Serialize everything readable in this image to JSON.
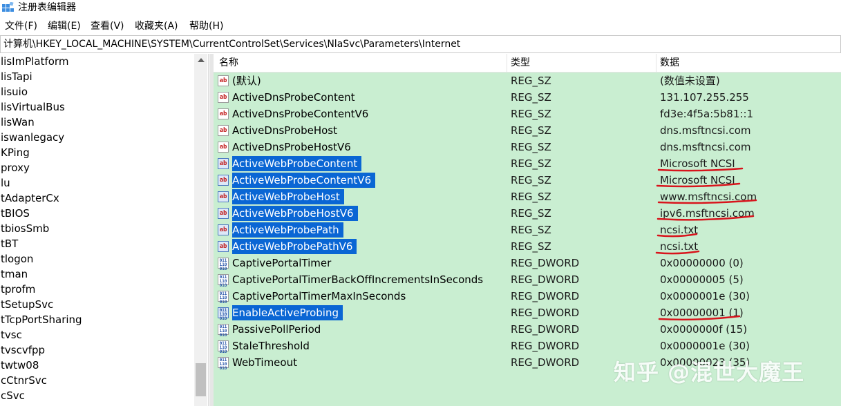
{
  "window": {
    "title": "注册表编辑器"
  },
  "menu": [
    "文件(F)",
    "编辑(E)",
    "查看(V)",
    "收藏夹(A)",
    "帮助(H)"
  ],
  "address": "计算机\\HKEY_LOCAL_MACHINE\\SYSTEM\\CurrentControlSet\\Services\\NlaSvc\\Parameters\\Internet",
  "tree": [
    "lisImPlatform",
    "lisTapi",
    "lisuio",
    "lisVirtualBus",
    "lisWan",
    "iswanlegacy",
    "KPing",
    "proxy",
    "lu",
    "tAdapterCx",
    "tBIOS",
    "tbiosSmb",
    "tBT",
    "tlogon",
    "tman",
    "tprofm",
    "tSetupSvc",
    "tTcpPortSharing",
    "tvsc",
    "tvscvfpp",
    "twtw08",
    "cCtnrSvc",
    "cSvc"
  ],
  "columns": {
    "name": "名称",
    "type": "类型",
    "data": "数据"
  },
  "values": [
    {
      "name": "(默认)",
      "type": "REG_SZ",
      "data": "(数值未设置)",
      "icon": "string-value-icon",
      "selected": false
    },
    {
      "name": "ActiveDnsProbeContent",
      "type": "REG_SZ",
      "data": "131.107.255.255",
      "icon": "string-value-icon",
      "selected": false
    },
    {
      "name": "ActiveDnsProbeContentV6",
      "type": "REG_SZ",
      "data": "fd3e:4f5a:5b81::1",
      "icon": "string-value-icon",
      "selected": false
    },
    {
      "name": "ActiveDnsProbeHost",
      "type": "REG_SZ",
      "data": "dns.msftncsi.com",
      "icon": "string-value-icon",
      "selected": false
    },
    {
      "name": "ActiveDnsProbeHostV6",
      "type": "REG_SZ",
      "data": "dns.msftncsi.com",
      "icon": "string-value-icon",
      "selected": false
    },
    {
      "name": "ActiveWebProbeContent",
      "type": "REG_SZ",
      "data": "Microsoft NCSI",
      "icon": "string-value-icon",
      "selected": true
    },
    {
      "name": "ActiveWebProbeContentV6",
      "type": "REG_SZ",
      "data": "Microsoft NCSI",
      "icon": "string-value-icon",
      "selected": true
    },
    {
      "name": "ActiveWebProbeHost",
      "type": "REG_SZ",
      "data": "www.msftncsi.com",
      "icon": "string-value-icon",
      "selected": true
    },
    {
      "name": "ActiveWebProbeHostV6",
      "type": "REG_SZ",
      "data": "ipv6.msftncsi.com",
      "icon": "string-value-icon",
      "selected": true
    },
    {
      "name": "ActiveWebProbePath",
      "type": "REG_SZ",
      "data": "ncsi.txt",
      "icon": "string-value-icon",
      "selected": true
    },
    {
      "name": "ActiveWebProbePathV6",
      "type": "REG_SZ",
      "data": "ncsi.txt",
      "icon": "string-value-icon",
      "selected": true
    },
    {
      "name": "CaptivePortalTimer",
      "type": "REG_DWORD",
      "data": "0x00000000 (0)",
      "icon": "dword-value-icon",
      "selected": false
    },
    {
      "name": "CaptivePortalTimerBackOffIncrementsInSeconds",
      "type": "REG_DWORD",
      "data": "0x00000005 (5)",
      "icon": "dword-value-icon",
      "selected": false
    },
    {
      "name": "CaptivePortalTimerMaxInSeconds",
      "type": "REG_DWORD",
      "data": "0x0000001e (30)",
      "icon": "dword-value-icon",
      "selected": false
    },
    {
      "name": "EnableActiveProbing",
      "type": "REG_DWORD",
      "data": "0x00000001 (1)",
      "icon": "dword-value-icon",
      "selected": true
    },
    {
      "name": "PassivePollPeriod",
      "type": "REG_DWORD",
      "data": "0x0000000f (15)",
      "icon": "dword-value-icon",
      "selected": false
    },
    {
      "name": "StaleThreshold",
      "type": "REG_DWORD",
      "data": "0x0000001e (30)",
      "icon": "dword-value-icon",
      "selected": false
    },
    {
      "name": "WebTimeout",
      "type": "REG_DWORD",
      "data": "0x00000023 (35)",
      "icon": "dword-value-icon",
      "selected": false
    }
  ],
  "watermark": "知乎 @混世大魔王",
  "colors": {
    "list_background": "#c9eed1",
    "selection": "#0a66d4",
    "annotation": "#d8141c"
  }
}
